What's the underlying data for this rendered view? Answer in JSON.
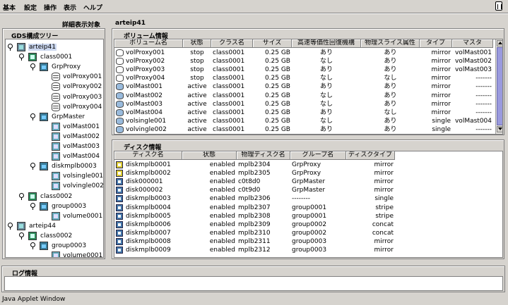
{
  "menu": {
    "items": [
      "基本",
      "設定",
      "操作",
      "表示",
      "ヘルプ"
    ]
  },
  "left": {
    "target_label": "詳細表示対象",
    "tree_title": "GDS構成ツリー"
  },
  "right": {
    "target_name": "arteip41"
  },
  "tree": [
    {
      "label": "arteip41",
      "icon": "host-icon",
      "level": 0,
      "selected": true
    },
    {
      "label": "class0001",
      "icon": "class-icon",
      "level": 1
    },
    {
      "label": "GrpProxy",
      "icon": "group-icon",
      "level": 2
    },
    {
      "label": "volProxy001",
      "icon": "volume-icon",
      "level": 3
    },
    {
      "label": "volProxy002",
      "icon": "volume-icon",
      "level": 3
    },
    {
      "label": "volProxy003",
      "icon": "volume-icon",
      "level": 3
    },
    {
      "label": "volProxy004",
      "icon": "volume-icon",
      "level": 3
    },
    {
      "label": "GrpMaster",
      "icon": "group-icon",
      "level": 2
    },
    {
      "label": "volMast001",
      "icon": "volume-active-icon",
      "level": 3
    },
    {
      "label": "volMast002",
      "icon": "volume-active-icon",
      "level": 3
    },
    {
      "label": "volMast003",
      "icon": "volume-active-icon",
      "level": 3
    },
    {
      "label": "volMast004",
      "icon": "volume-active-icon",
      "level": 3
    },
    {
      "label": "diskmplb0003",
      "icon": "group-icon",
      "level": 2
    },
    {
      "label": "volsingle001",
      "icon": "volume-active-icon",
      "level": 3
    },
    {
      "label": "volvingle002",
      "icon": "volume-active-icon",
      "level": 3
    },
    {
      "label": "class0002",
      "icon": "class-icon",
      "level": 1
    },
    {
      "label": "group0003",
      "icon": "group-icon",
      "level": 2
    },
    {
      "label": "volume0001",
      "icon": "volume-active-icon",
      "level": 3
    },
    {
      "label": "arteip44",
      "icon": "host-icon",
      "level": 0
    },
    {
      "label": "class0002",
      "icon": "class-icon",
      "level": 1
    },
    {
      "label": "group0003",
      "icon": "group-icon",
      "level": 2
    },
    {
      "label": "volume0001",
      "icon": "volume-active-icon",
      "level": 3
    }
  ],
  "volume_panel": {
    "title": "ボリューム情報",
    "columns": [
      "ボリューム名",
      "状態",
      "クラス名",
      "サイズ",
      "高速等価性回復機構",
      "物理スライス属性",
      "タイプ",
      "マスタ"
    ],
    "rows": [
      [
        "volProxy001",
        "stop",
        "class0001",
        "0.25 GB",
        "あり",
        "あり",
        "mirror",
        "volMast001"
      ],
      [
        "volProxy002",
        "stop",
        "class0001",
        "0.25 GB",
        "なし",
        "あり",
        "mirror",
        "volMast002"
      ],
      [
        "volProxy003",
        "stop",
        "class0001",
        "0.25 GB",
        "あり",
        "あり",
        "mirror",
        "volMast003"
      ],
      [
        "volProxy004",
        "stop",
        "class0001",
        "0.25 GB",
        "なし",
        "なし",
        "mirror",
        "-------"
      ],
      [
        "volMast001",
        "active",
        "class0001",
        "0.25 GB",
        "あり",
        "あり",
        "mirror",
        "-------"
      ],
      [
        "volMast002",
        "active",
        "class0001",
        "0.25 GB",
        "なし",
        "あり",
        "mirror",
        "-------"
      ],
      [
        "volMast003",
        "active",
        "class0001",
        "0.25 GB",
        "なし",
        "あり",
        "mirror",
        "-------"
      ],
      [
        "volMast004",
        "active",
        "class0001",
        "0.25 GB",
        "あり",
        "なし",
        "mirror",
        "-------"
      ],
      [
        "volsingle001",
        "active",
        "class0001",
        "0.25 GB",
        "なし",
        "あり",
        "single",
        "volMast004"
      ],
      [
        "volvingle002",
        "active",
        "class0001",
        "0.25 GB",
        "あり",
        "あり",
        "single",
        "-------"
      ]
    ],
    "row_icons": [
      "plain",
      "plain",
      "plain",
      "plain",
      "active",
      "active",
      "active",
      "active",
      "active",
      "active"
    ]
  },
  "disk_panel": {
    "title": "ディスク情報",
    "columns": [
      "ディスク名",
      "状態",
      "物理ディスク名",
      "グループ名",
      "ディスクタイプ"
    ],
    "rows": [
      [
        "diskmplb0001",
        "enabled",
        "mplb2304",
        "GrpProxy",
        "mirror"
      ],
      [
        "diskmplb0002",
        "enabled",
        "mplb2305",
        "GrpProxy",
        "mirror"
      ],
      [
        "disk000001",
        "enabled",
        "c0t8d0",
        "GrpMaster",
        "mirror"
      ],
      [
        "disk000002",
        "enabled",
        "c0t9d0",
        "GrpMaster",
        "mirror"
      ],
      [
        "diskmplb0003",
        "enabled",
        "mplb2306",
        "--------",
        "single"
      ],
      [
        "diskmplb0004",
        "enabled",
        "mplb2307",
        "group0001",
        "stripe"
      ],
      [
        "diskmplb0005",
        "enabled",
        "mplb2308",
        "group0001",
        "stripe"
      ],
      [
        "diskmplb0006",
        "enabled",
        "mplb2309",
        "group0002",
        "concat"
      ],
      [
        "diskmplb0007",
        "enabled",
        "mplb2310",
        "group0002",
        "concat"
      ],
      [
        "diskmplb0008",
        "enabled",
        "mplb2311",
        "group0003",
        "mirror"
      ],
      [
        "diskmplb0009",
        "enabled",
        "mplb2312",
        "group0003",
        "mirror"
      ]
    ],
    "row_icons": [
      "yellow",
      "yellow",
      "blue",
      "blue",
      "blue",
      "blue",
      "blue",
      "blue",
      "blue",
      "blue",
      "blue"
    ]
  },
  "log_panel": {
    "title": "ログ情報"
  },
  "status_bar": {
    "text": "Java Applet Window"
  }
}
